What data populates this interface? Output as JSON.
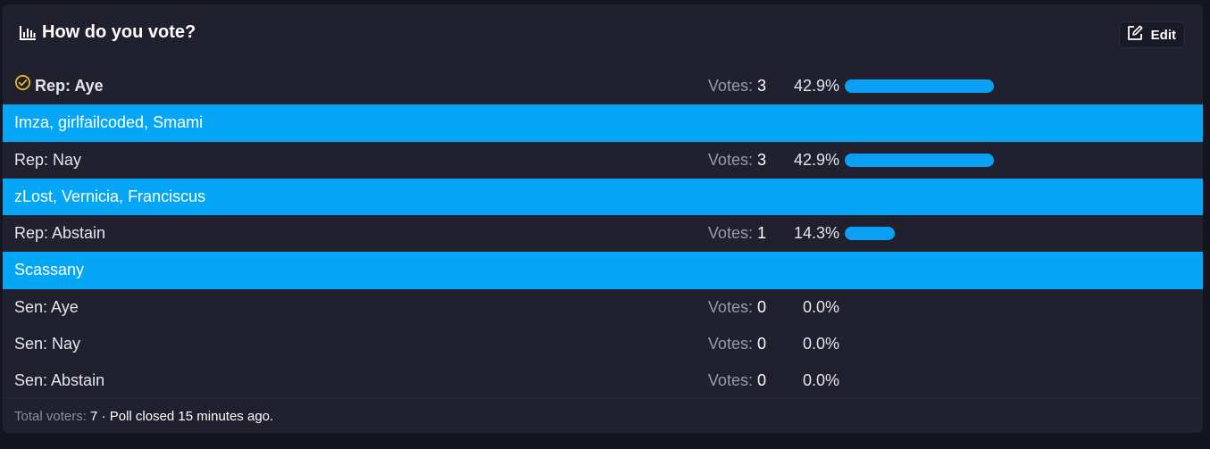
{
  "poll": {
    "title": "How do you vote?",
    "edit_label": "Edit",
    "votes_label": "Votes:",
    "options": [
      {
        "label": "Rep: Aye",
        "votes": "3",
        "percent": "42.9%",
        "fraction": 0.429,
        "voted": true,
        "voters": "Imza, girlfailcoded, Smami"
      },
      {
        "label": "Rep: Nay",
        "votes": "3",
        "percent": "42.9%",
        "fraction": 0.429,
        "voted": false,
        "voters": "zLost, Vernicia, Franciscus"
      },
      {
        "label": "Rep: Abstain",
        "votes": "1",
        "percent": "14.3%",
        "fraction": 0.143,
        "voted": false,
        "voters": "Scassany"
      },
      {
        "label": "Sen: Aye",
        "votes": "0",
        "percent": "0.0%",
        "fraction": 0,
        "voted": false,
        "voters": ""
      },
      {
        "label": "Sen: Nay",
        "votes": "0",
        "percent": "0.0%",
        "fraction": 0,
        "voted": false,
        "voters": ""
      },
      {
        "label": "Sen: Abstain",
        "votes": "0",
        "percent": "0.0%",
        "fraction": 0,
        "voted": false,
        "voters": ""
      }
    ],
    "footer": {
      "total_label": "Total voters:",
      "total_value": "7",
      "status": "· Poll closed 15 minutes ago."
    }
  },
  "colors": {
    "accent": "#0aa0f5",
    "voters_band": "#05a6f6",
    "check": "#f0c020",
    "card_bg": "#20202e"
  },
  "icons": {
    "title_icon": "bar-chart-icon",
    "edit_icon": "edit-icon",
    "voted_icon": "check-circle-icon"
  }
}
